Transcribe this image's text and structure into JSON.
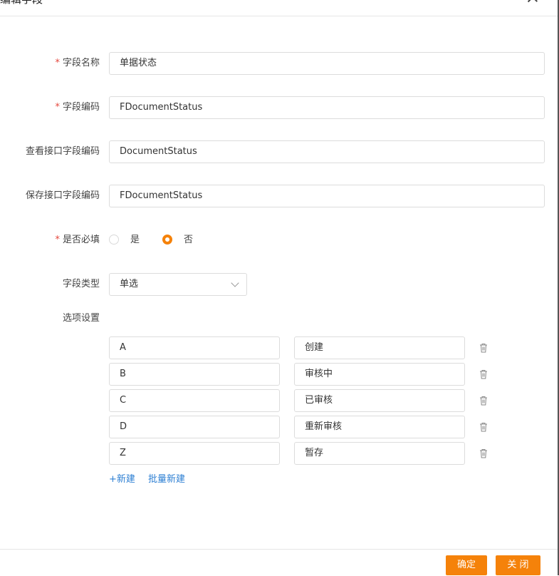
{
  "dialog": {
    "title": "编辑字段"
  },
  "form": {
    "field_name": {
      "label": "字段名称",
      "required_mark": "*",
      "value": "单据状态"
    },
    "field_code": {
      "label": "字段编码",
      "required_mark": "*",
      "value": "FDocumentStatus"
    },
    "view_api_code": {
      "label": "查看接口字段编码",
      "value": "DocumentStatus"
    },
    "save_api_code": {
      "label": "保存接口字段编码",
      "value": "FDocumentStatus"
    },
    "is_required": {
      "label": "是否必填",
      "required_mark": "*",
      "options": [
        {
          "label": "是",
          "checked": false
        },
        {
          "label": "否",
          "checked": true
        }
      ]
    },
    "field_type": {
      "label": "字段类型",
      "value": "单选"
    },
    "options_settings": {
      "label": "选项设置",
      "items": [
        {
          "key": "A",
          "value": "创建"
        },
        {
          "key": "B",
          "value": "审核中"
        },
        {
          "key": "C",
          "value": "已审核"
        },
        {
          "key": "D",
          "value": "重新审核"
        },
        {
          "key": "Z",
          "value": "暂存"
        }
      ],
      "add_label": "+新建",
      "batch_add_label": "批量新建"
    }
  },
  "footer": {
    "confirm_label": "确定",
    "close_label": "关 闭"
  },
  "colors": {
    "accent": "#f5820a",
    "link": "#2d7fd3",
    "required": "#e5473d"
  },
  "icons": {
    "close": "close-icon",
    "delete": "trash-icon",
    "select_arrow": "chevron-down-icon"
  }
}
